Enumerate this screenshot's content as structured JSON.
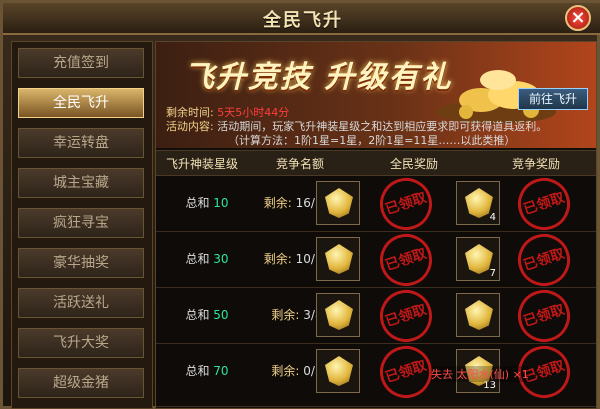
{
  "window": {
    "title": "全民飞升",
    "close_label": "×"
  },
  "sidebar": {
    "items": [
      {
        "label": "充值签到",
        "active": false
      },
      {
        "label": "全民飞升",
        "active": true
      },
      {
        "label": "幸运转盘",
        "active": false
      },
      {
        "label": "城主宝藏",
        "active": false
      },
      {
        "label": "疯狂寻宝",
        "active": false
      },
      {
        "label": "豪华抽奖",
        "active": false
      },
      {
        "label": "活跃送礼",
        "active": false
      },
      {
        "label": "飞升大奖",
        "active": false
      },
      {
        "label": "超级金猪",
        "active": false
      }
    ]
  },
  "banner": {
    "title": "飞升竞技  升级有礼",
    "goto_button": "前往飞升"
  },
  "info": {
    "remaining_label": "剩余时间:",
    "remaining_value": "5天5小时44分",
    "activity_label": "活动内容:",
    "activity_text": "活动期间，玩家飞升神装星级之和达到相应要求即可获得道具返利。",
    "formula_text": "（计算方法：1阶1星=1星，2阶1星=11星……以此类推）"
  },
  "table": {
    "headers": [
      "飞升神装星级",
      "竞争名额",
      "全民奖励",
      "竞争奖励"
    ],
    "rows": [
      {
        "star_prefix": "总和",
        "star_value": "10",
        "remain_label": "剩余:",
        "remain_value": "16/30",
        "right_count": "4",
        "stamp": "已领取"
      },
      {
        "star_prefix": "总和",
        "star_value": "30",
        "remain_label": "剩余:",
        "remain_value": "10/15",
        "right_count": "7",
        "stamp": "已领取"
      },
      {
        "star_prefix": "总和",
        "star_value": "50",
        "remain_label": "剩余:",
        "remain_value": "3/8",
        "right_count": "",
        "stamp": "已领取"
      },
      {
        "star_prefix": "总和",
        "star_value": "70",
        "remain_label": "剩余:",
        "remain_value": "0/3",
        "right_count": "13",
        "stamp": "已领取"
      }
    ]
  },
  "notice": "失去 太阳水(仙) ×1"
}
